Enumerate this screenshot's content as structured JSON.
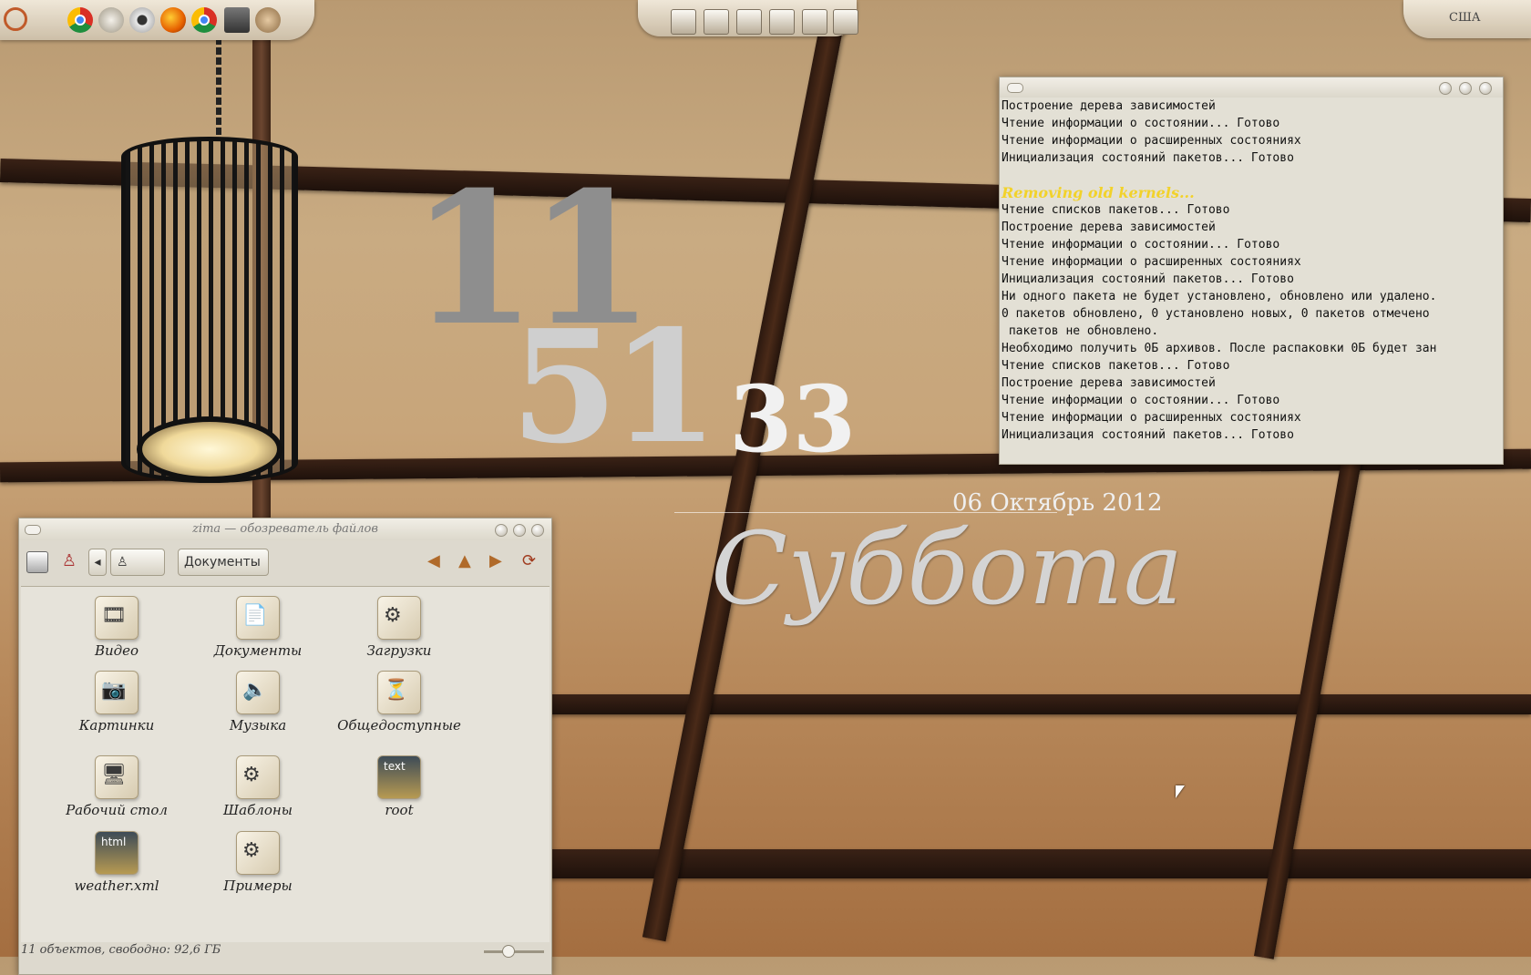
{
  "top_panel": {
    "launchers": [
      "chrome-icon",
      "teapot-icon",
      "webcam-icon",
      "firefox-icon",
      "chrome-icon",
      "monitor-icon",
      "settings-icon"
    ],
    "tray": [
      "eye-icon",
      "document-icon",
      "video-icon",
      "camera-icon",
      "film-icon",
      "list-icon"
    ],
    "keyboard_layout": "США"
  },
  "clock": {
    "hours": "11",
    "minutes": "51",
    "seconds": "33"
  },
  "date": {
    "full": "06 Октябрь 2012",
    "weekday": "Суббота"
  },
  "terminal": {
    "lines": [
      "Построение дерева зависимостей",
      "Чтение информации о состоянии... Готово",
      "Чтение информации о расширенных состояниях",
      "Инициализация состояний пакетов... Готово",
      "",
      "Removing old kernels...",
      "Чтение списков пакетов... Готово",
      "Построение дерева зависимостей",
      "Чтение информации о состоянии... Готово",
      "Чтение информации о расширенных состояниях",
      "Инициализация состояний пакетов... Готово",
      "Ни одного пакета не будет установлено, обновлено или удалено.",
      "0 пакетов обновлено, 0 установлено новых, 0 пакетов отмечено",
      " пакетов не обновлено.",
      "Необходимо получить 0Б архивов. После распаковки 0Б будет зан",
      "Чтение списков пакетов... Готово",
      "Построение дерева зависимостей",
      "Чтение информации о состоянии... Готово",
      "Чтение информации о расширенных состояниях",
      "Инициализация состояний пакетов... Готово"
    ],
    "warn_line_index": 5
  },
  "file_manager": {
    "title": "zima — обозреватель файлов",
    "breadcrumb_current": "Документы",
    "items": [
      {
        "label": "Видео",
        "icon": "video-folder-icon",
        "glyph": "🎞"
      },
      {
        "label": "Документы",
        "icon": "documents-folder-icon",
        "glyph": "📄"
      },
      {
        "label": "Загрузки",
        "icon": "downloads-folder-icon",
        "glyph": "⚙"
      },
      {
        "label": "Картинки",
        "icon": "pictures-folder-icon",
        "glyph": "📷"
      },
      {
        "label": "Музыка",
        "icon": "music-folder-icon",
        "glyph": "🔈"
      },
      {
        "label": "Общедоступные",
        "icon": "public-folder-icon",
        "glyph": "⏳"
      },
      {
        "label": "Рабочий стол",
        "icon": "desktop-folder-icon",
        "glyph": "🖥"
      },
      {
        "label": "Шаблоны",
        "icon": "templates-folder-icon",
        "glyph": "⚙"
      },
      {
        "label": "root",
        "icon": "root-link-icon",
        "glyph": "text"
      },
      {
        "label": "weather.xml",
        "icon": "html-file-icon",
        "glyph": "html"
      },
      {
        "label": "Примеры",
        "icon": "examples-folder-icon",
        "glyph": "⚙"
      }
    ],
    "status": "11 объектов, свободно: 92,6 ГБ"
  }
}
